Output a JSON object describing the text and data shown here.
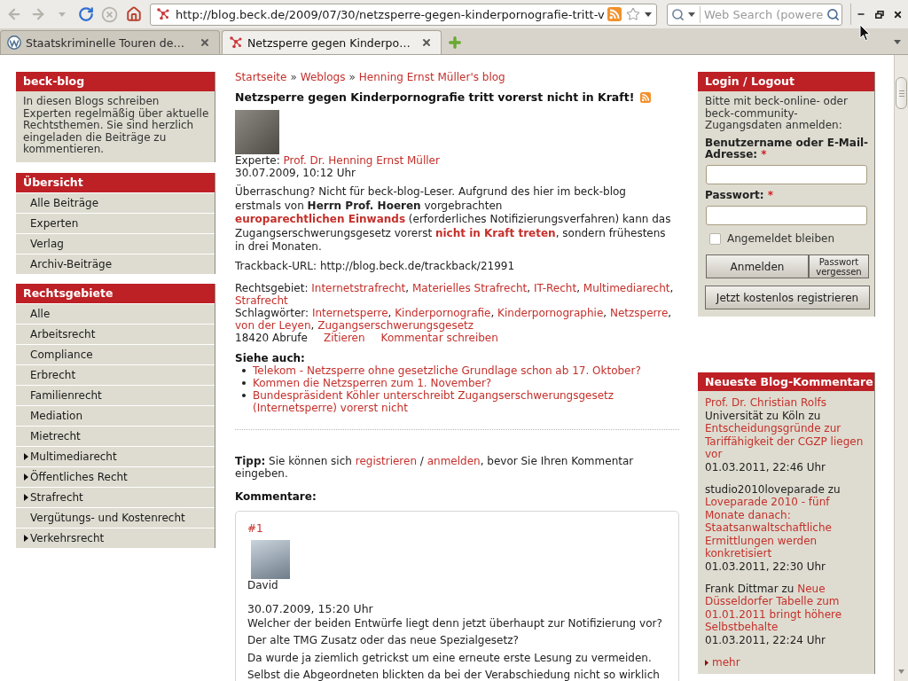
{
  "browser": {
    "nav_buttons": [
      {
        "kind": "back",
        "disabled": true
      },
      {
        "kind": "forward",
        "disabled": true
      },
      {
        "kind": "history",
        "disabled": true
      },
      {
        "kind": "reload",
        "disabled": false
      },
      {
        "kind": "stop",
        "disabled": true
      },
      {
        "kind": "home",
        "disabled": false
      }
    ],
    "url": "http://blog.beck.de/2009/07/30/netzsperre-gegen-kinderpornografie-tritt-v",
    "search": {
      "placeholder": "Web Search (powere"
    },
    "tabs": [
      {
        "title": "Staatskriminelle Touren de…",
        "kind": "circle-logo",
        "selected": false
      },
      {
        "title": "Netzsperre gegen Kinderpo…",
        "kind": "dots-logo",
        "selected": true
      }
    ]
  },
  "left_sidebar": {
    "intro": {
      "title": "beck-blog",
      "text": "In diesen Blogs schreiben Experten regelmäßig über aktuelle Rechtsthemen. Sie sind herzlich eingeladen die Beiträge zu kommentieren."
    },
    "menus": [
      {
        "title": "Übersicht",
        "items": [
          {
            "label": "Alle Beiträge",
            "kind": "leaf"
          },
          {
            "label": "Experten",
            "kind": "leaf"
          },
          {
            "label": "Verlag",
            "kind": "leaf"
          },
          {
            "label": "Archiv-Beiträge",
            "kind": "leaf"
          }
        ]
      },
      {
        "title": "Rechtsgebiete",
        "items": [
          {
            "label": "Alle",
            "kind": "leaf"
          },
          {
            "label": "Arbeitsrecht",
            "kind": "leaf"
          },
          {
            "label": "Compliance",
            "kind": "leaf"
          },
          {
            "label": "Erbrecht",
            "kind": "leaf"
          },
          {
            "label": "Familienrecht",
            "kind": "leaf"
          },
          {
            "label": "Mediation",
            "kind": "leaf"
          },
          {
            "label": "Mietrecht",
            "kind": "leaf"
          },
          {
            "label": "Multimediarecht",
            "kind": "parent"
          },
          {
            "label": "Öffentliches Recht",
            "kind": "parent"
          },
          {
            "label": "Strafrecht",
            "kind": "parent"
          },
          {
            "label": "Vergütungs- und Kostenrecht",
            "kind": "leaf"
          },
          {
            "label": "Verkehrsrecht",
            "kind": "parent"
          }
        ]
      }
    ]
  },
  "article": {
    "breadcrumb": [
      {
        "kind": "link",
        "text": "Startseite"
      },
      {
        "kind": "separator",
        "text": "»"
      },
      {
        "kind": "link",
        "text": "Weblogs"
      },
      {
        "kind": "separator",
        "text": "»"
      },
      {
        "kind": "link",
        "text": "Henning Ernst Müller's blog"
      }
    ],
    "title": "Netzsperre gegen Kinderpornografie tritt vorerst nicht in Kraft!",
    "author_line": [
      {
        "kind": "text",
        "text": "Experte: "
      },
      {
        "kind": "link",
        "text": "Prof. Dr. Henning Ernst Müller"
      }
    ],
    "date": "30.07.2009, 10:12 Uhr",
    "body": [
      {
        "kind": "text",
        "text": "Überraschung? Nicht für beck-blog-Leser. Aufgrund des hier im beck-blog erstmals von "
      },
      {
        "kind": "bold",
        "text": "Herrn Prof. Hoeren"
      },
      {
        "kind": "text",
        "text": " vorgebrachten "
      },
      {
        "kind": "bold-link",
        "text": "europarechtlichen "
      },
      {
        "kind": "bold-link",
        "text": "Einwands"
      },
      {
        "kind": "text",
        "text": " (erforderliches Notifizierungsverfahren) kann das Zugangserschwerungsgesetz vorerst "
      },
      {
        "kind": "bold-link",
        "text": "nicht in Kraft treten"
      },
      {
        "kind": "text",
        "text": ", sondern frühestens in drei Monaten."
      }
    ],
    "trackback": "Trackback-URL: http://blog.beck.de/trackback/21991",
    "categories": [
      {
        "kind": "text",
        "text": "Rechtsgebiet: "
      },
      {
        "kind": "link",
        "text": "Internetstrafrecht"
      },
      {
        "kind": "text",
        "text": ", "
      },
      {
        "kind": "link",
        "text": "Materielles Strafrecht"
      },
      {
        "kind": "text",
        "text": ", "
      },
      {
        "kind": "link",
        "text": "IT-Recht"
      },
      {
        "kind": "text",
        "text": ", "
      },
      {
        "kind": "link",
        "text": "Multimediarecht"
      },
      {
        "kind": "text",
        "text": ", "
      },
      {
        "kind": "link",
        "text": "Strafrecht"
      }
    ],
    "tags": [
      {
        "kind": "text",
        "text": "Schlagwörter: "
      },
      {
        "kind": "link",
        "text": "Internetsperre"
      },
      {
        "kind": "text",
        "text": ", "
      },
      {
        "kind": "link",
        "text": "Kinderpornografie"
      },
      {
        "kind": "text",
        "text": ", "
      },
      {
        "kind": "link",
        "text": "Kinderpornographie"
      },
      {
        "kind": "text",
        "text": ", "
      },
      {
        "kind": "link",
        "text": "Netzsperre"
      },
      {
        "kind": "text",
        "text": ", "
      },
      {
        "kind": "link",
        "text": "von der Leyen"
      },
      {
        "kind": "text",
        "text": ", "
      },
      {
        "kind": "link",
        "text": "Zugangserschwerungsgesetz"
      }
    ],
    "views": "18420 Abrufe",
    "actions": [
      "Zitieren",
      "Kommentar schreiben"
    ],
    "see_also": {
      "title": "Siehe auch:",
      "links": [
        "Telekom - Netzsperre ohne gesetzliche Grundlage schon ab 17. Oktober?",
        "Kommen die Netzsperren zum 1. November?",
        "Bundespräsident Köhler unterschreibt Zugangserschwerungsgesetz (Internetsperre) vorerst nicht"
      ]
    },
    "tip": [
      {
        "kind": "bold",
        "text": "Tipp:"
      },
      {
        "kind": "text",
        "text": " Sie können sich "
      },
      {
        "kind": "link",
        "text": "registrieren"
      },
      {
        "kind": "text",
        "text": " / "
      },
      {
        "kind": "link",
        "text": "anmelden"
      },
      {
        "kind": "text",
        "text": ", bevor Sie Ihren Kommentar eingeben."
      }
    ],
    "comments_title": "Kommentare:",
    "comments": [
      {
        "number": "#1",
        "author": "David",
        "date": "30.07.2009, 15:20 Uhr",
        "lines": [
          "Welcher der beiden Entwürfe liegt denn jetzt überhaupt zur Notifizierung vor?",
          "Der alte TMG Zusatz oder das neue Spezialgesetz?",
          "Da wurde ja ziemlich getrickst um eine erneute erste Lesung zu vermeiden.",
          "Selbst die Abgeordneten blickten da bei der Verabschiedung nicht so wirklich"
        ]
      }
    ]
  },
  "right_sidebar": {
    "login": {
      "title": "Login / Logout",
      "intro": "Bitte mit beck-online- oder beck-community-Zugangsdaten anmelden:",
      "fields": [
        {
          "label": "Benutzername oder E-Mail-Adresse:",
          "required_mark": "*"
        },
        {
          "label": "Passwort:",
          "required_mark": "*"
        }
      ],
      "remember": {
        "label": "Angemeldet bleiben",
        "checked": false
      },
      "buttons": [
        "Anmelden",
        "Passwort vergessen"
      ],
      "register": "Jetzt kostenlos registrieren"
    },
    "recent": {
      "title": "Neueste Blog-Kommentare",
      "entries": [
        {
          "segments": [
            {
              "kind": "link",
              "text": "Prof. Dr. Christian Rolfs"
            },
            {
              "kind": "text",
              "text": " Universität zu Köln zu "
            },
            {
              "kind": "block-link",
              "text": "Entscheidungsgründe zur Tariffähigkeit der CGZP liegen vor"
            }
          ],
          "date": "01.03.2011, 22:46 Uhr"
        },
        {
          "segments": [
            {
              "kind": "text",
              "text": "studio2010loveparade zu "
            },
            {
              "kind": "block-link",
              "text": "Loveparade 2010 - fünf Monate danach: Staatsanwaltschaftliche Ermittlungen werden konkretisiert"
            }
          ],
          "date": "01.03.2011, 22:30 Uhr"
        },
        {
          "segments": [
            {
              "kind": "text",
              "text": "Frank Dittmar zu "
            },
            {
              "kind": "link",
              "text": "Neue"
            },
            {
              "kind": "block-link",
              "text": "Düsseldorfer Tabelle zum 01.01.2011 bringt höhere Selbstbehalte"
            }
          ],
          "date": "01.03.2011, 22:24 Uhr"
        }
      ],
      "more": "mehr"
    }
  }
}
